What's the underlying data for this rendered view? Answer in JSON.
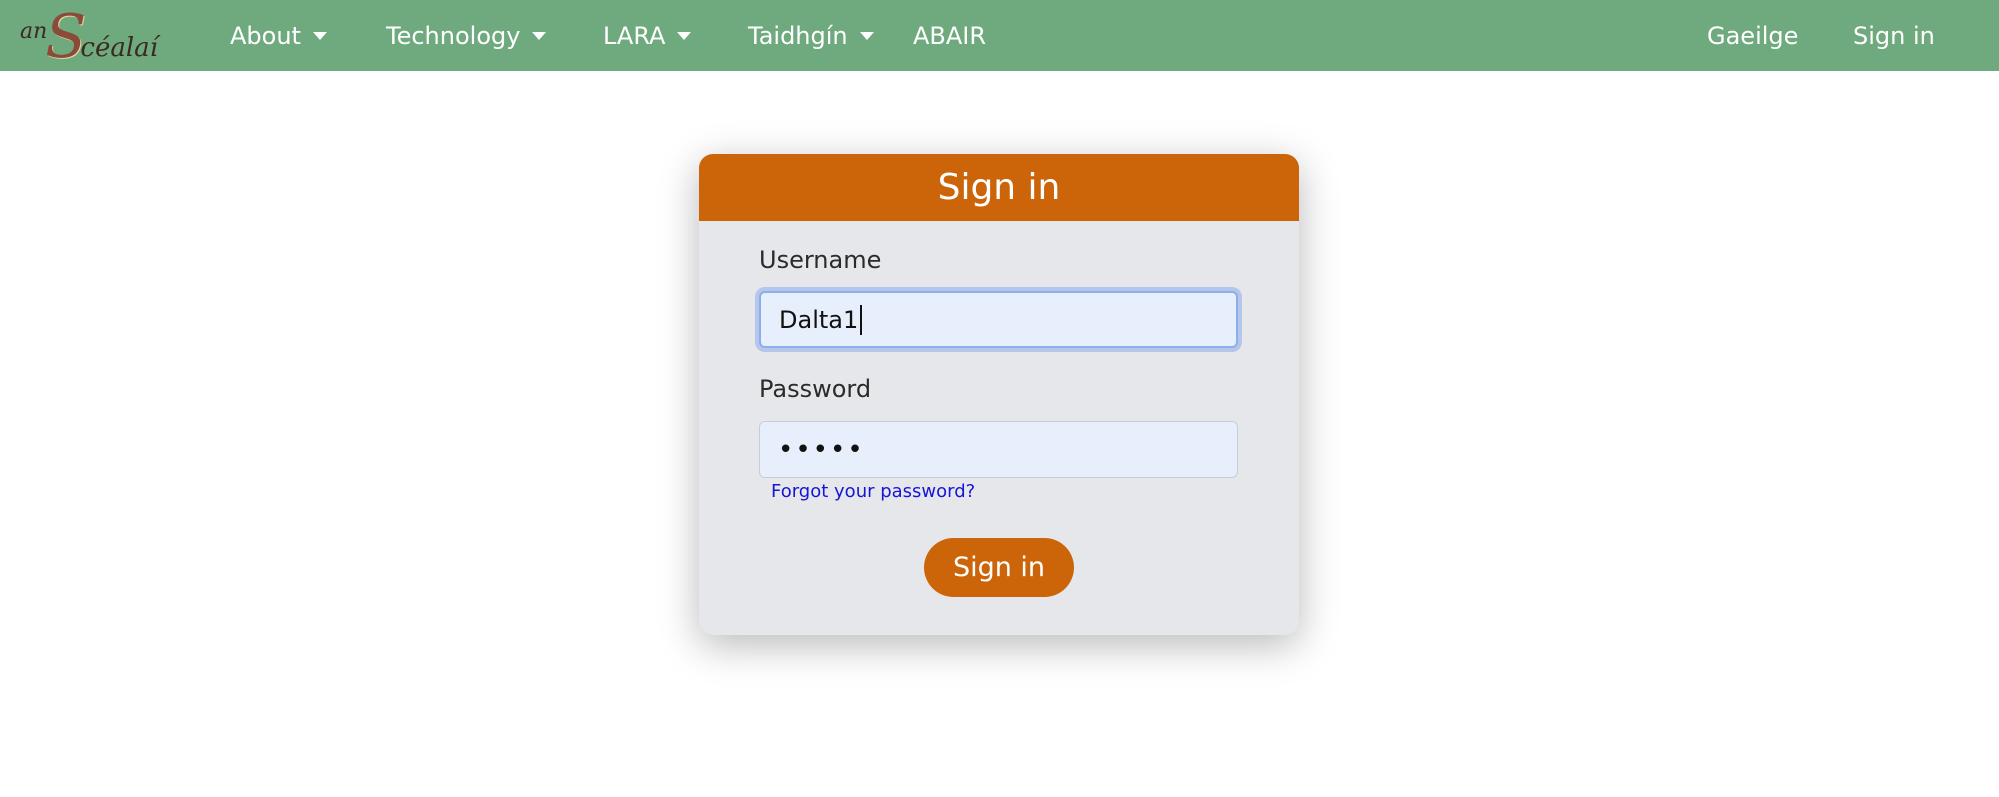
{
  "navbar": {
    "logo": {
      "prefix": "an",
      "initial": "S",
      "rest": "céalaí"
    },
    "items": [
      {
        "label": "About",
        "has_dropdown": true
      },
      {
        "label": "Technology",
        "has_dropdown": true
      },
      {
        "label": "LARA",
        "has_dropdown": true
      },
      {
        "label": "Taidhgín",
        "has_dropdown": true
      },
      {
        "label": "ABAIR",
        "has_dropdown": false
      }
    ],
    "right_items": [
      {
        "label": "Gaeilge"
      },
      {
        "label": "Sign in"
      }
    ],
    "background_color": "#6faa7f"
  },
  "signin_form": {
    "title": "Sign in",
    "header_color": "#cc6509",
    "username": {
      "label": "Username",
      "value": "Dalta1"
    },
    "password": {
      "label": "Password",
      "masked_value": "•••••"
    },
    "forgot_link": "Forgot your password?",
    "submit_label": "Sign in"
  }
}
